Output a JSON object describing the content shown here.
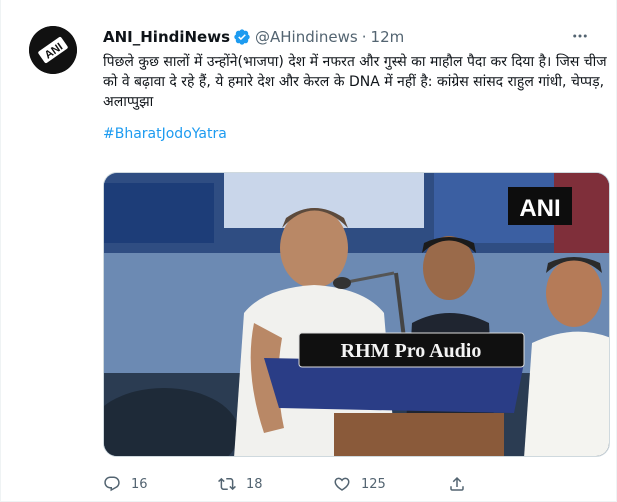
{
  "tweet": {
    "display_name": "ANI_HindiNews",
    "handle": "@AHindinews",
    "separator": "·",
    "time": "12m",
    "text": "पिछले कुछ सालों में उन्होंने(भाजपा) देश में नफरत और गुस्से का माहौल पैदा कर दिया है। जिस चीज को वे बढ़ावा दे रहे हैं, ये हमारे देश और केरल के DNA में नहीं है: कांग्रेस सांसद राहुल गांधी, चेप्पड़, अलाप्पुझा",
    "hashtag": "#BharatJodoYatra",
    "avatar_label": "ANI",
    "media": {
      "watermark": "ANI",
      "podium_label": "RHM Pro Audio"
    }
  },
  "actions": {
    "reply_count": "16",
    "retweet_count": "18",
    "like_count": "125"
  },
  "colors": {
    "link": "#1d9bf0",
    "verified": "#1d9bf0",
    "muted": "#536471"
  },
  "icons": [
    "more-icon",
    "verified-badge-icon",
    "reply-icon",
    "retweet-icon",
    "like-icon",
    "share-icon"
  ]
}
